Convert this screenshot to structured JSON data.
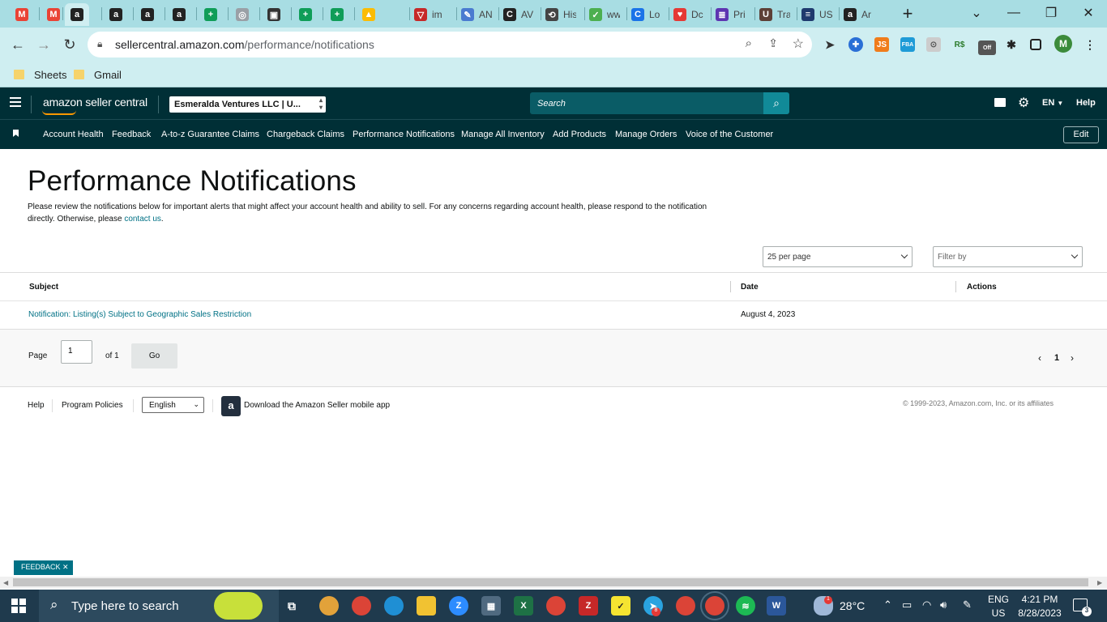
{
  "browser": {
    "tabs": [
      {
        "label": "",
        "icon": "gmail-icon"
      },
      {
        "label": "",
        "icon": "gmail-icon"
      },
      {
        "label": "",
        "icon": "amazon-icon",
        "active": true
      },
      {
        "label": "",
        "icon": "amazon-icon"
      },
      {
        "label": "",
        "icon": "amazon-icon"
      },
      {
        "label": "",
        "icon": "amazon-icon"
      },
      {
        "label": "",
        "icon": "sheets-icon"
      },
      {
        "label": "",
        "icon": "globe-icon"
      },
      {
        "label": "",
        "icon": "app-icon"
      },
      {
        "label": "",
        "icon": "sheets-icon"
      },
      {
        "label": "",
        "icon": "sheets-icon"
      },
      {
        "label": "",
        "icon": "drive-icon"
      },
      {
        "label": "im",
        "icon": "v-icon"
      },
      {
        "label": "AN",
        "icon": "pen-icon"
      },
      {
        "label": "AV",
        "icon": "c-icon"
      },
      {
        "label": "His",
        "icon": "history-icon"
      },
      {
        "label": "ww",
        "icon": "leaf-icon"
      },
      {
        "label": "Lo",
        "icon": "c-blue-icon"
      },
      {
        "label": "Dc",
        "icon": "heart-icon"
      },
      {
        "label": "Pri",
        "icon": "list-icon"
      },
      {
        "label": "Tra",
        "icon": "ups-icon"
      },
      {
        "label": "US",
        "icon": "usps-icon"
      },
      {
        "label": "Ar",
        "icon": "amazon-icon"
      }
    ],
    "new_tab": "+",
    "url_host": "sellercentral.amazon.com",
    "url_path": "/performance/notifications",
    "bookmarks": [
      "Sheets",
      "Gmail"
    ],
    "profile_initial": "M",
    "ext_off_badge": "Off"
  },
  "seller": {
    "logo": "amazon seller central",
    "account": "Esmeralda Ventures LLC | U...",
    "search_placeholder": "Search",
    "lang": "EN",
    "help": "Help",
    "nav": [
      "Account Health",
      "Feedback",
      "A-to-z Guarantee Claims",
      "Chargeback Claims",
      "Performance Notifications",
      "Manage All Inventory",
      "Add Products",
      "Manage Orders",
      "Voice of the Customer"
    ],
    "edit": "Edit"
  },
  "page": {
    "title": "Performance Notifications",
    "intro": "Please review the notifications below for important alerts that might affect your account health and ability to sell. For any concerns regarding account health, please respond to the notification directly. Otherwise, please ",
    "contact_link": "contact us",
    "per_page": "25 per page",
    "filter": "Filter by",
    "columns": {
      "subject": "Subject",
      "date": "Date",
      "actions": "Actions"
    },
    "rows": [
      {
        "subject": "Notification: Listing(s) Subject to Geographic Sales Restriction",
        "date": "August 4, 2023"
      }
    ],
    "pager": {
      "page_label": "Page",
      "page_value": "1",
      "of_label": "of 1",
      "go": "Go",
      "current": "1"
    },
    "footer": {
      "help": "Help",
      "policies": "Program Policies",
      "language": "English",
      "app": "Download the Amazon Seller mobile app",
      "copyright": "© 1999-2023, Amazon.com, Inc. or its affiliates"
    },
    "feedback": "FEEDBACK"
  },
  "taskbar": {
    "search_placeholder": "Type here to search",
    "weather": "28°C",
    "lang1": "ENG",
    "lang2": "US",
    "time": "4:21 PM",
    "date": "8/28/2023",
    "notif_count": "3",
    "badge_8": "8",
    "badge_1": "1"
  }
}
